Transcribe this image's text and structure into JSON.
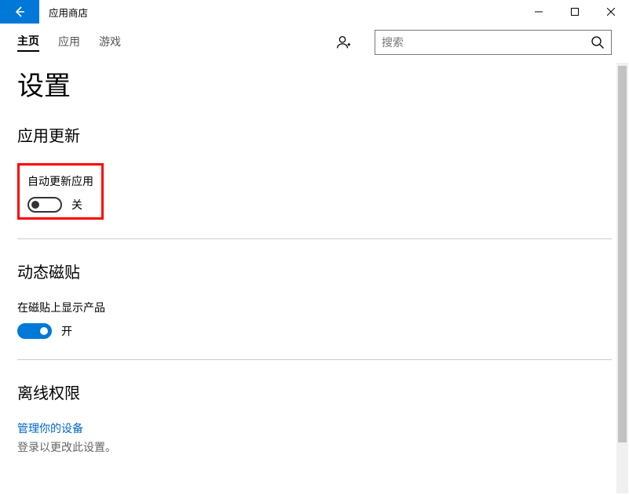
{
  "window": {
    "title": "应用商店"
  },
  "nav": {
    "items": [
      {
        "label": "主页",
        "active": true
      },
      {
        "label": "应用",
        "active": false
      },
      {
        "label": "游戏",
        "active": false
      }
    ]
  },
  "search": {
    "placeholder": "搜索"
  },
  "page": {
    "title": "设置"
  },
  "sections": {
    "app_updates": {
      "title": "应用更新",
      "setting_label": "自动更新应用",
      "toggle_on": false,
      "state_text": "关"
    },
    "live_tiles": {
      "title": "动态磁贴",
      "setting_label": "在磁贴上显示产品",
      "toggle_on": true,
      "state_text": "开"
    },
    "offline": {
      "title": "离线权限",
      "link": "管理你的设备",
      "hint": "登录以更改此设置。"
    }
  }
}
